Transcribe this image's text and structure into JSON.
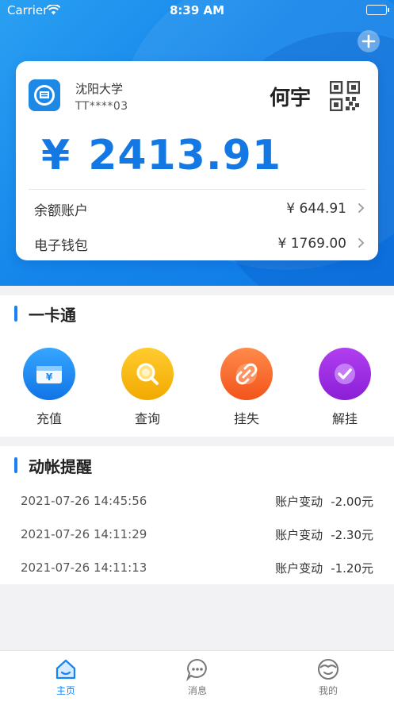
{
  "status_bar": {
    "carrier": "Carrier",
    "time": "8:39 AM"
  },
  "card": {
    "school_name": "沈阳大学",
    "card_id": "TT****03",
    "holder_name": "何宇",
    "total_balance": "2413.91",
    "currency_symbol": "¥",
    "accounts": [
      {
        "label": "余额账户",
        "amount": "¥ 644.91"
      },
      {
        "label": "电子钱包",
        "amount": "¥ 1769.00"
      }
    ]
  },
  "one_card": {
    "title": "一卡通",
    "functions": [
      {
        "label": "充值",
        "icon": "recharge-icon",
        "color": "#1a8cf0"
      },
      {
        "label": "查询",
        "icon": "search-icon",
        "color": "#f5b800"
      },
      {
        "label": "挂失",
        "icon": "link-icon",
        "color": "#ff6a2c"
      },
      {
        "label": "解挂",
        "icon": "check-icon",
        "color": "#9b2ee0"
      }
    ]
  },
  "activity": {
    "title": "动帐提醒",
    "items": [
      {
        "datetime": "2021-07-26 14:45:56",
        "type": "账户变动",
        "amount": "-2.00元"
      },
      {
        "datetime": "2021-07-26 14:11:29",
        "type": "账户变动",
        "amount": "-2.30元"
      },
      {
        "datetime": "2021-07-26 14:11:13",
        "type": "账户变动",
        "amount": "-1.20元"
      }
    ]
  },
  "tabbar": {
    "items": [
      {
        "label": "主页",
        "icon": "home-icon",
        "active": true
      },
      {
        "label": "消息",
        "icon": "message-icon",
        "active": false
      },
      {
        "label": "我的",
        "icon": "profile-icon",
        "active": false
      }
    ]
  },
  "colors": {
    "accent": "#1883f0",
    "hero": "#1485ea"
  }
}
